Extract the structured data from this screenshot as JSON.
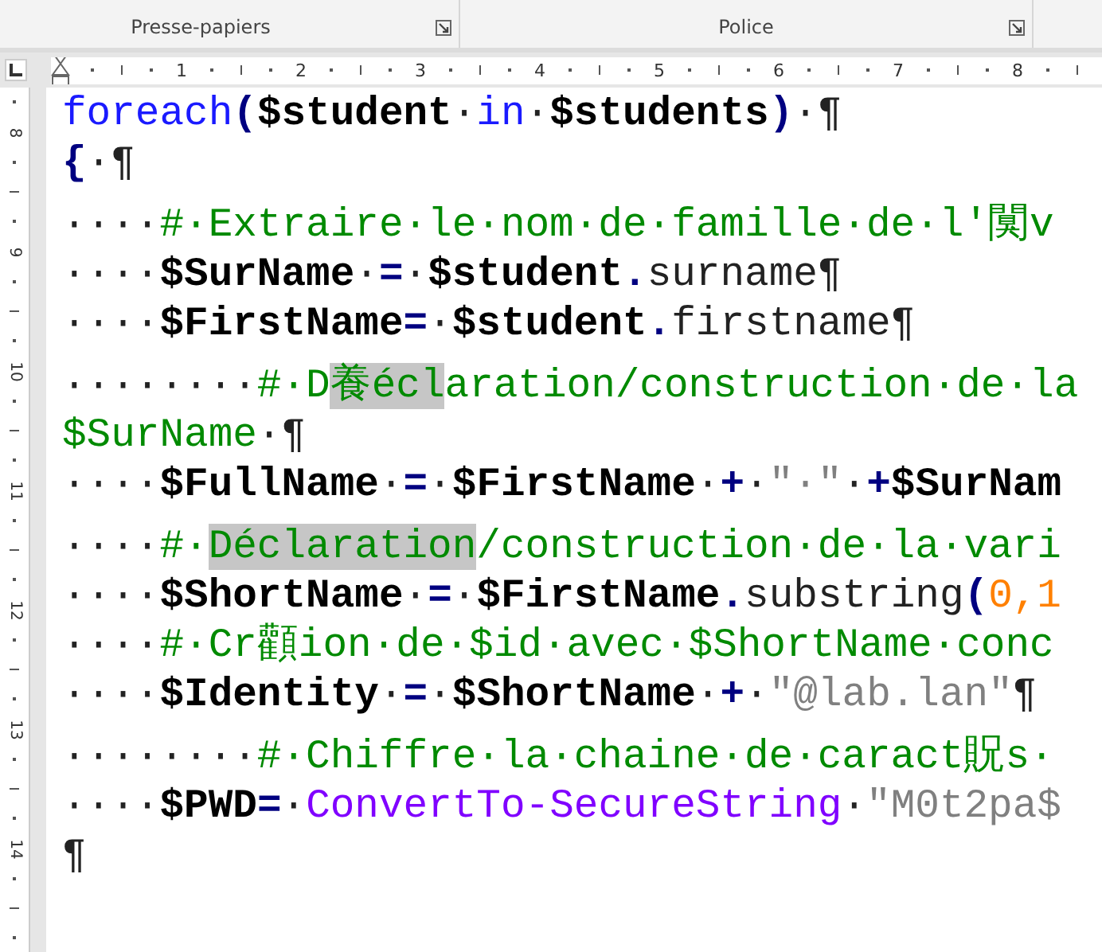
{
  "ribbon_groups": [
    {
      "label": "Presse-papiers"
    },
    {
      "label": "Police"
    }
  ],
  "ruler": {
    "marks": [
      "1",
      "2",
      "3",
      "4",
      "5",
      "6",
      "7",
      "8"
    ]
  },
  "vertical_ruler": {
    "marks": [
      "8",
      "9",
      "10",
      "11",
      "12",
      "13",
      "14"
    ]
  },
  "document": {
    "lines": [
      {
        "kind": "code",
        "segments": [
          {
            "kind": "keyword",
            "text": "foreach"
          },
          {
            "kind": "op",
            "text": "("
          },
          {
            "kind": "var",
            "text": "$student"
          },
          {
            "kind": "plain",
            "text": "·"
          },
          {
            "kind": "keyword",
            "text": "in"
          },
          {
            "kind": "plain",
            "text": "·"
          },
          {
            "kind": "var",
            "text": "$students"
          },
          {
            "kind": "op",
            "text": ")"
          },
          {
            "kind": "plain",
            "text": "·¶"
          }
        ]
      },
      {
        "kind": "code",
        "segments": [
          {
            "kind": "op",
            "text": "{"
          },
          {
            "kind": "plain",
            "text": "·¶"
          }
        ]
      },
      {
        "kind": "comment",
        "segments": [
          {
            "kind": "plain",
            "text": "····"
          },
          {
            "kind": "comment",
            "text": "#·Extraire·le·nom·de·famille·de·l'闃v"
          }
        ]
      },
      {
        "kind": "code",
        "segments": [
          {
            "kind": "plain",
            "text": "····"
          },
          {
            "kind": "var",
            "text": "$SurName"
          },
          {
            "kind": "plain",
            "text": "·"
          },
          {
            "kind": "op",
            "text": "="
          },
          {
            "kind": "plain",
            "text": "·"
          },
          {
            "kind": "var",
            "text": "$student"
          },
          {
            "kind": "op",
            "text": "."
          },
          {
            "kind": "plain",
            "text": "surname¶"
          }
        ]
      },
      {
        "kind": "code",
        "segments": [
          {
            "kind": "plain",
            "text": "····"
          },
          {
            "kind": "var",
            "text": "$FirstName"
          },
          {
            "kind": "op",
            "text": "="
          },
          {
            "kind": "plain",
            "text": "·"
          },
          {
            "kind": "var",
            "text": "$student"
          },
          {
            "kind": "op",
            "text": "."
          },
          {
            "kind": "plain",
            "text": "firstname¶"
          }
        ]
      },
      {
        "kind": "comment",
        "segments": [
          {
            "kind": "plain",
            "text": "········"
          },
          {
            "kind": "comment",
            "text": "#·D"
          },
          {
            "kind": "comment",
            "text": "養écl",
            "highlighted": true
          },
          {
            "kind": "comment",
            "text": "aration/construction·de·la"
          }
        ]
      },
      {
        "kind": "code",
        "segments": [
          {
            "kind": "comment",
            "text": "$SurName"
          },
          {
            "kind": "plain",
            "text": "·¶"
          }
        ]
      },
      {
        "kind": "code",
        "segments": [
          {
            "kind": "plain",
            "text": "····"
          },
          {
            "kind": "var",
            "text": "$FullName"
          },
          {
            "kind": "plain",
            "text": "·"
          },
          {
            "kind": "op",
            "text": "="
          },
          {
            "kind": "plain",
            "text": "·"
          },
          {
            "kind": "var",
            "text": "$FirstName"
          },
          {
            "kind": "plain",
            "text": "·"
          },
          {
            "kind": "op",
            "text": "+"
          },
          {
            "kind": "plain",
            "text": "·"
          },
          {
            "kind": "string",
            "text": "\"·\""
          },
          {
            "kind": "plain",
            "text": "·"
          },
          {
            "kind": "op",
            "text": "+"
          },
          {
            "kind": "var",
            "text": "$SurNam"
          }
        ]
      },
      {
        "kind": "comment",
        "segments": [
          {
            "kind": "plain",
            "text": "····"
          },
          {
            "kind": "comment",
            "text": "#·"
          },
          {
            "kind": "comment",
            "text": "Déclaration",
            "highlighted": true
          },
          {
            "kind": "comment",
            "text": "/construction·de·la·vari"
          }
        ]
      },
      {
        "kind": "code",
        "segments": [
          {
            "kind": "plain",
            "text": "····"
          },
          {
            "kind": "var",
            "text": "$ShortName"
          },
          {
            "kind": "plain",
            "text": "·"
          },
          {
            "kind": "op",
            "text": "="
          },
          {
            "kind": "plain",
            "text": "·"
          },
          {
            "kind": "var",
            "text": "$FirstName"
          },
          {
            "kind": "op",
            "text": "."
          },
          {
            "kind": "plain",
            "text": "substring"
          },
          {
            "kind": "op",
            "text": "("
          },
          {
            "kind": "number",
            "text": "0,1"
          }
        ]
      },
      {
        "kind": "code",
        "segments": [
          {
            "kind": "plain",
            "text": "····"
          },
          {
            "kind": "comment",
            "text": "#·Cr顴ion·de·$id·avec·$ShortName·conc"
          }
        ]
      },
      {
        "kind": "code",
        "segments": [
          {
            "kind": "plain",
            "text": "····"
          },
          {
            "kind": "var",
            "text": "$Identity"
          },
          {
            "kind": "plain",
            "text": "·"
          },
          {
            "kind": "op",
            "text": "="
          },
          {
            "kind": "plain",
            "text": "·"
          },
          {
            "kind": "var",
            "text": "$ShortName"
          },
          {
            "kind": "plain",
            "text": "·"
          },
          {
            "kind": "op",
            "text": "+"
          },
          {
            "kind": "plain",
            "text": "·"
          },
          {
            "kind": "string",
            "text": "\"@lab.lan\""
          },
          {
            "kind": "plain",
            "text": "¶"
          }
        ]
      },
      {
        "kind": "comment",
        "segments": [
          {
            "kind": "plain",
            "text": "········"
          },
          {
            "kind": "comment",
            "text": "#·Chiffre·la·chaine·de·caract貺s·"
          }
        ]
      },
      {
        "kind": "code",
        "segments": [
          {
            "kind": "plain",
            "text": "····"
          },
          {
            "kind": "var",
            "text": "$PWD"
          },
          {
            "kind": "op",
            "text": "="
          },
          {
            "kind": "plain",
            "text": "·"
          },
          {
            "kind": "cmdlet",
            "text": "ConvertTo-SecureString"
          },
          {
            "kind": "plain",
            "text": "·"
          },
          {
            "kind": "string",
            "text": "\"M0t2pa$"
          }
        ]
      },
      {
        "kind": "code",
        "segments": [
          {
            "kind": "plain",
            "text": "¶"
          }
        ]
      }
    ]
  }
}
